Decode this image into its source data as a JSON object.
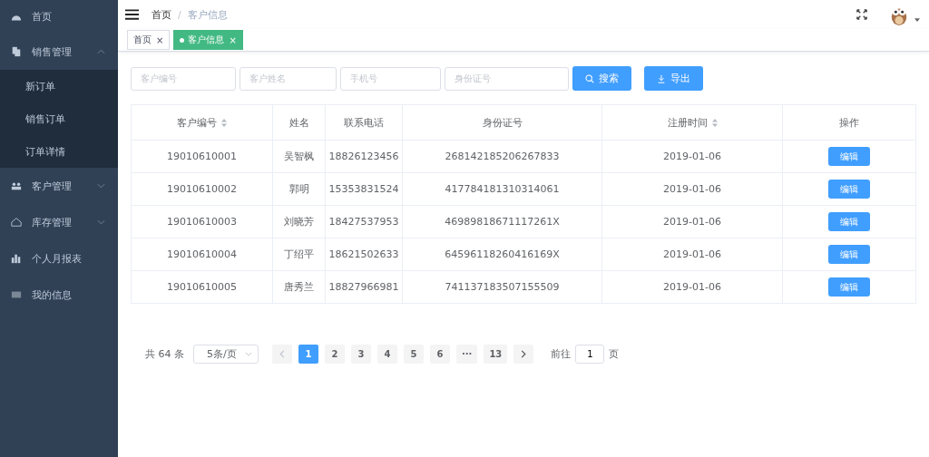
{
  "sidebar": {
    "items": [
      {
        "label": "首页"
      },
      {
        "label": "销售管理",
        "expanded": true,
        "children": [
          {
            "label": "新订单"
          },
          {
            "label": "销售订单"
          },
          {
            "label": "订单详情"
          }
        ]
      },
      {
        "label": "客户管理",
        "expanded": false
      },
      {
        "label": "库存管理",
        "expanded": false
      },
      {
        "label": "个人月报表"
      },
      {
        "label": "我的信息"
      }
    ]
  },
  "breadcrumb": {
    "separator": "/",
    "items": [
      "首页",
      "客户信息"
    ]
  },
  "tabs": [
    {
      "label": "首页",
      "close": "×",
      "selected": false
    },
    {
      "label": "客户信息",
      "close": "×",
      "selected": true
    }
  ],
  "filters": [
    {
      "placeholder": "客户编号"
    },
    {
      "placeholder": "客户姓名"
    },
    {
      "placeholder": "手机号"
    },
    {
      "placeholder": "身份证号"
    }
  ],
  "buttons": [
    {
      "label": "搜索"
    },
    {
      "label": "导出"
    }
  ],
  "table": {
    "columns": [
      {
        "label": "客户编号",
        "sortable": true
      },
      {
        "label": "姓名",
        "sortable": false
      },
      {
        "label": "联系电话",
        "sortable": false
      },
      {
        "label": "身份证号",
        "sortable": false
      },
      {
        "label": "注册时间",
        "sortable": true
      },
      {
        "label": "操作",
        "sortable": false
      }
    ],
    "rows": [
      {
        "id": "19010610001",
        "name": "吴智枫",
        "phone": "18826123456",
        "idcard": "268142185206267833",
        "date": "2019-01-06",
        "action": "编辑"
      },
      {
        "id": "19010610002",
        "name": "郭明",
        "phone": "15353831524",
        "idcard": "417784181310314061",
        "date": "2019-01-06",
        "action": "编辑"
      },
      {
        "id": "19010610003",
        "name": "刘晓芳",
        "phone": "18427537953",
        "idcard": "46989818671117261X",
        "date": "2019-01-06",
        "action": "编辑"
      },
      {
        "id": "19010610004",
        "name": "丁绍平",
        "phone": "18621502633",
        "idcard": "64596118260416169X",
        "date": "2019-01-06",
        "action": "编辑"
      },
      {
        "id": "19010610005",
        "name": "唐秀兰",
        "phone": "18827966981",
        "idcard": "741137183507155509",
        "date": "2019-01-06",
        "action": "编辑"
      }
    ]
  },
  "pagination": {
    "total": "共 64 条",
    "page_size": "5条/页",
    "pages": [
      {
        "label": "1",
        "selected": true
      },
      {
        "label": "2",
        "selected": false
      },
      {
        "label": "3",
        "selected": false
      },
      {
        "label": "4",
        "selected": false
      },
      {
        "label": "5",
        "selected": false
      },
      {
        "label": "6",
        "selected": false
      },
      {
        "label": "···",
        "selected": false
      },
      {
        "label": "13",
        "selected": false
      }
    ],
    "goto_label": "前往",
    "goto_value": "1",
    "goto_suffix": "页"
  }
}
